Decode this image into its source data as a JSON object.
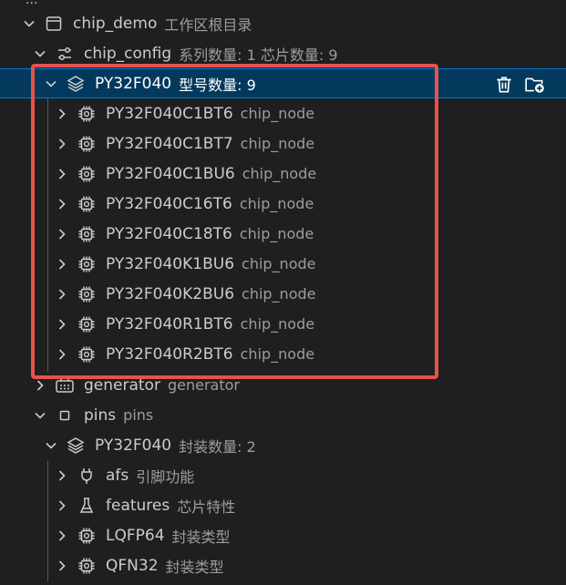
{
  "header_clip": "...",
  "tree": {
    "workspace": {
      "label": "chip_demo",
      "desc": "工作区根目录"
    },
    "chip_config": {
      "label": "chip_config",
      "desc": "系列数量: 1 芯片数量: 9"
    },
    "series": {
      "label": "PY32F040",
      "desc": "型号数量: 9"
    },
    "chips": [
      {
        "label": "PY32F040C1BT6",
        "desc": "chip_node"
      },
      {
        "label": "PY32F040C1BT7",
        "desc": "chip_node"
      },
      {
        "label": "PY32F040C1BU6",
        "desc": "chip_node"
      },
      {
        "label": "PY32F040C16T6",
        "desc": "chip_node"
      },
      {
        "label": "PY32F040C18T6",
        "desc": "chip_node"
      },
      {
        "label": "PY32F040K1BU6",
        "desc": "chip_node"
      },
      {
        "label": "PY32F040K2BU6",
        "desc": "chip_node"
      },
      {
        "label": "PY32F040R1BT6",
        "desc": "chip_node"
      },
      {
        "label": "PY32F040R2BT6",
        "desc": "chip_node"
      }
    ],
    "generator": {
      "label": "generator",
      "desc": "generator"
    },
    "pins": {
      "label": "pins",
      "desc": "pins"
    },
    "pins_series": {
      "label": "PY32F040",
      "desc": "封装数量: 2"
    },
    "pins_children": [
      {
        "label": "afs",
        "desc": "引脚功能",
        "icon": "plug-icon"
      },
      {
        "label": "features",
        "desc": "芯片特性",
        "icon": "flask-icon"
      },
      {
        "label": "LQFP64",
        "desc": "封装类型",
        "icon": "chip-icon"
      },
      {
        "label": "QFN32",
        "desc": "封装类型",
        "icon": "chip-icon"
      }
    ]
  },
  "colors": {
    "selected_bg": "#04395e",
    "highlight": "#e5534b",
    "desc": "#9d9d9d"
  }
}
